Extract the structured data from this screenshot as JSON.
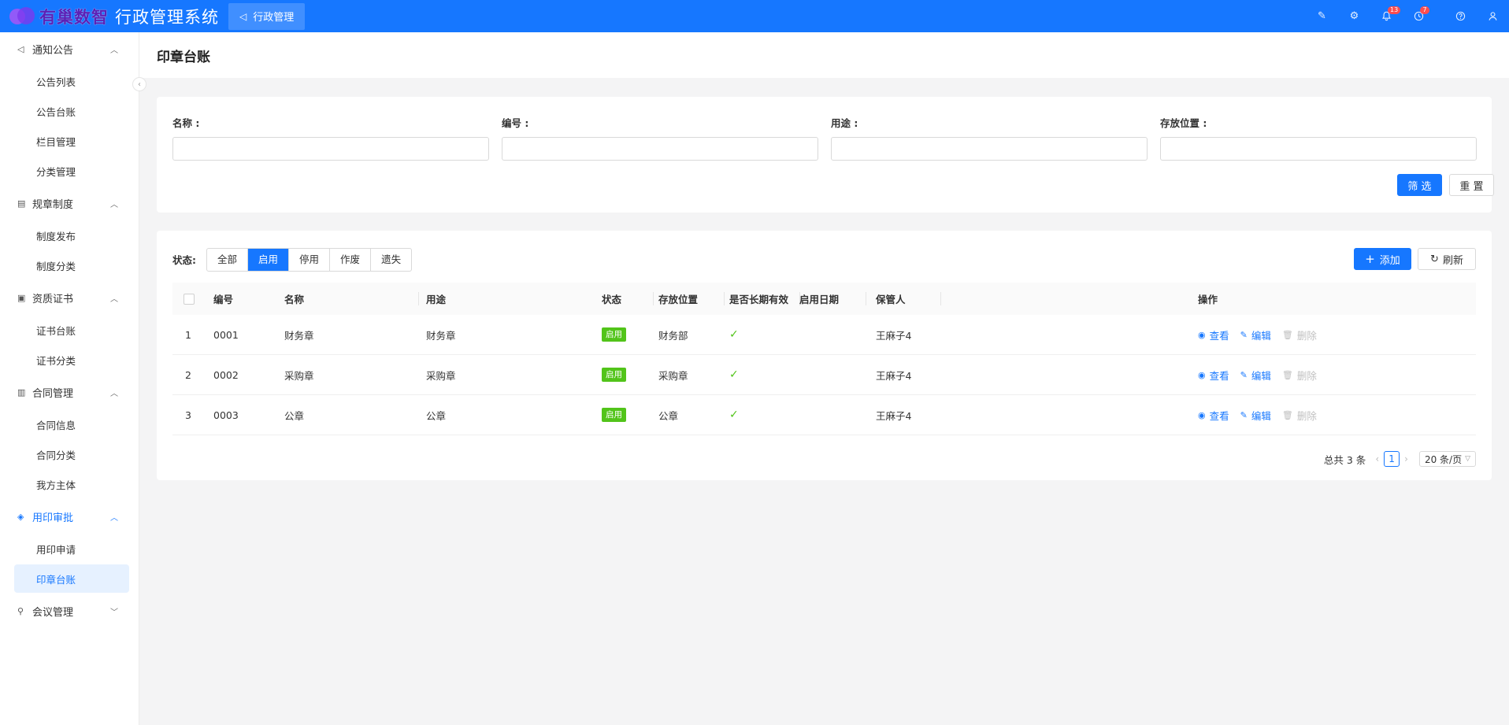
{
  "header": {
    "logo_text": "有巢数智",
    "app_title": "行政管理系统",
    "module_tab": "行政管理",
    "icons": [
      "pen-icon",
      "settings-icon",
      "bell-icon",
      "clock-icon",
      "help-icon",
      "user-icon"
    ],
    "bell_badge": "13",
    "clock_badge": "7",
    "brand_color": "#1677ff"
  },
  "sidebar": {
    "groups": [
      {
        "title": "通知公告",
        "icon": "megaphone-icon",
        "expanded": true,
        "items": [
          "公告列表",
          "公告台账",
          "栏目管理",
          "分类管理"
        ]
      },
      {
        "title": "规章制度",
        "icon": "rulebook-icon",
        "expanded": true,
        "items": [
          "制度发布",
          "制度分类"
        ]
      },
      {
        "title": "资质证书",
        "icon": "certificate-icon",
        "expanded": true,
        "items": [
          "证书台账",
          "证书分类"
        ]
      },
      {
        "title": "合同管理",
        "icon": "contract-icon",
        "expanded": true,
        "items": [
          "合同信息",
          "合同分类",
          "我方主体"
        ]
      },
      {
        "title": "用印审批",
        "icon": "seal-icon",
        "expanded": true,
        "active": true,
        "items": [
          "用印申请",
          "印章台账"
        ],
        "selected": "印章台账"
      },
      {
        "title": "会议管理",
        "icon": "meeting-icon",
        "expanded": false,
        "items": []
      }
    ]
  },
  "page": {
    "title": "印章台账"
  },
  "filter": {
    "fields": [
      {
        "label": "名称 :",
        "value": "",
        "placeholder": ""
      },
      {
        "label": "编号 :",
        "value": "",
        "placeholder": ""
      },
      {
        "label": "用途 :",
        "value": "",
        "placeholder": ""
      },
      {
        "label": "存放位置 :",
        "value": "",
        "placeholder": ""
      }
    ],
    "search_button": "筛 选",
    "reset_button": "重 置"
  },
  "status_filter": {
    "label": "状态:",
    "options": [
      "全部",
      "启用",
      "停用",
      "作废",
      "遗失"
    ],
    "selected": "启用"
  },
  "toolbar": {
    "add_label": "添加",
    "refresh_label": "刷新"
  },
  "table": {
    "columns": [
      "编号",
      "名称",
      "用途",
      "状态",
      "存放位置",
      "是否长期有效",
      "启用日期",
      "保管人",
      "操作"
    ],
    "rows": [
      {
        "index": "1",
        "code": "0001",
        "name": "财务章",
        "purpose": "财务章",
        "status": "启用",
        "location": "财务部",
        "long_term": true,
        "start_date": "",
        "keeper": "王麻子4"
      },
      {
        "index": "2",
        "code": "0002",
        "name": "采购章",
        "purpose": "采购章",
        "status": "启用",
        "location": "采购章",
        "long_term": true,
        "start_date": "",
        "keeper": "王麻子4"
      },
      {
        "index": "3",
        "code": "0003",
        "name": "公章",
        "purpose": "公章",
        "status": "启用",
        "location": "公章",
        "long_term": true,
        "start_date": "",
        "keeper": "王麻子4"
      }
    ],
    "actions": {
      "view": "查看",
      "edit": "编辑",
      "delete": "删除"
    },
    "status_color": "#52c41a"
  },
  "pagination": {
    "total_text": "总共 3 条",
    "current_page": "1",
    "page_size": "20 条/页"
  }
}
